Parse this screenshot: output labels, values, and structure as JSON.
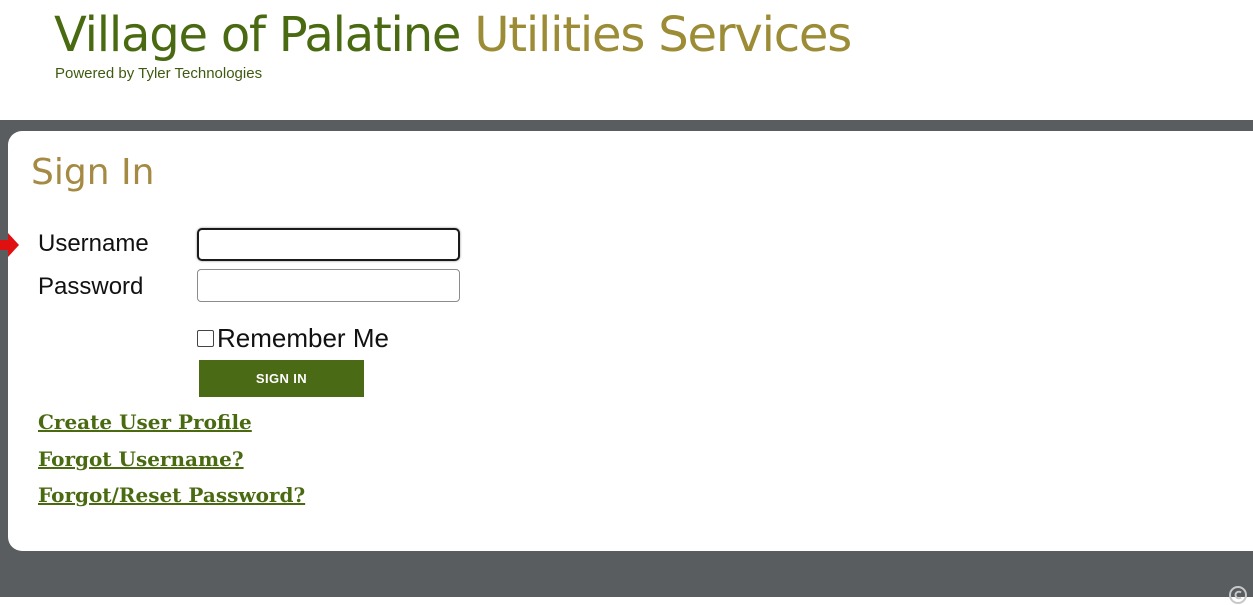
{
  "header": {
    "title_main": "Village of Palatine",
    "title_secondary": "Utilities Services",
    "powered_by": "Powered by Tyler Technologies"
  },
  "signin": {
    "heading": "Sign In",
    "username_label": "Username",
    "username_value": "",
    "password_label": "Password",
    "password_value": "",
    "remember_label": "Remember Me",
    "remember_checked": false,
    "button_label": "SIGN IN"
  },
  "links": {
    "create_profile": "Create User Profile",
    "forgot_username": "Forgot Username?",
    "forgot_password": "Forgot/Reset Password?"
  },
  "icons": {
    "pointer_arrow": "arrow-right-icon",
    "footer_symbol": "copyright-icon"
  },
  "colors": {
    "brand_green": "#4a6a12",
    "brand_gold": "#9c8c36",
    "heading_gold": "#a58a44",
    "frame_gray": "#595d60",
    "button_green": "#4a6a15",
    "pointer_red": "#e01010"
  }
}
